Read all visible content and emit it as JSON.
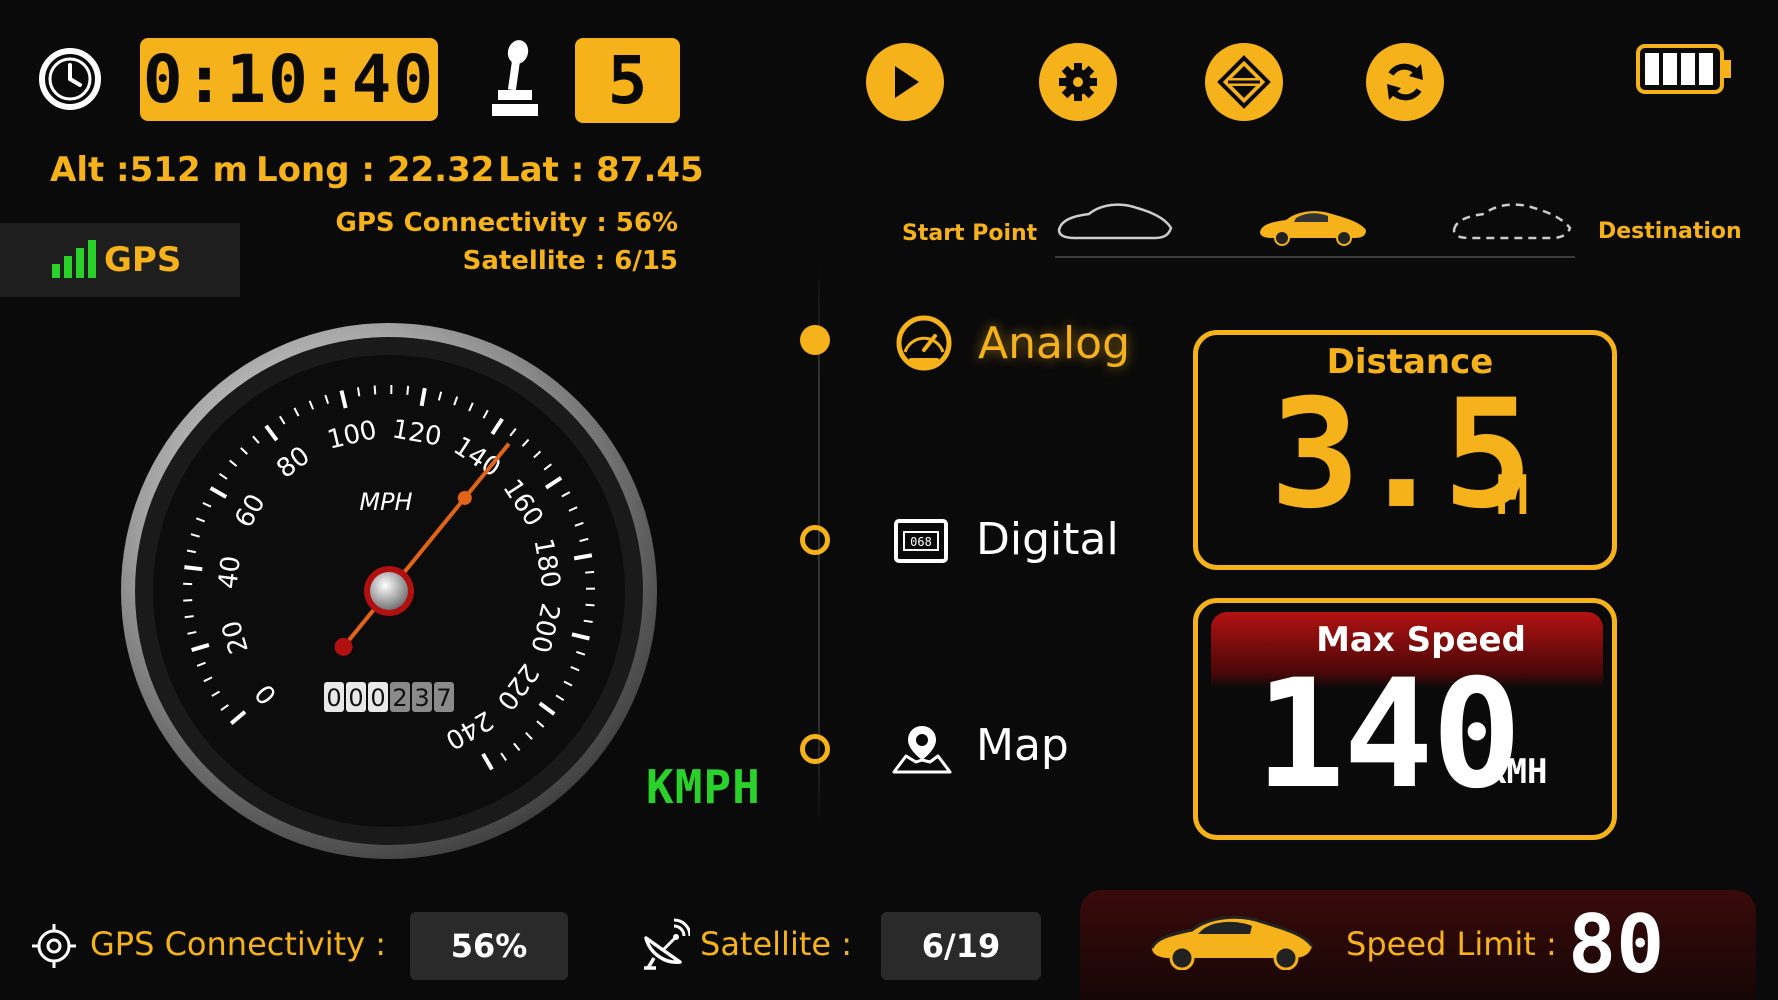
{
  "header": {
    "timer": "0:10:40",
    "gear": "5"
  },
  "location": {
    "alt": "Alt :512 m",
    "long": "Long : 22.32",
    "lat": "Lat : 87.45",
    "gps_connectivity": "GPS Connectivity : 56%",
    "satellite": "Satellite : 6/15"
  },
  "gps_badge": {
    "label": "GPS"
  },
  "route": {
    "start": "Start Point",
    "destination": "Destination"
  },
  "modes": [
    {
      "label": "Analog",
      "selected": true
    },
    {
      "label": "Digital",
      "selected": false
    },
    {
      "label": "Map",
      "selected": false
    }
  ],
  "distance": {
    "title": "Distance",
    "value": "3.5",
    "unit": "M"
  },
  "max_speed": {
    "title": "Max Speed",
    "value": "140",
    "unit": "KMH"
  },
  "speedometer": {
    "unit_label": "MPH",
    "ticks": [
      "0",
      "20",
      "40",
      "60",
      "80",
      "100",
      "120",
      "140",
      "160",
      "180",
      "200",
      "220",
      "240"
    ],
    "needle_value": 145,
    "max_value": 240,
    "odometer": [
      "0",
      "0",
      "0",
      "2",
      "3",
      "7"
    ]
  },
  "unit_toggle": "KMPH",
  "footer": {
    "gps_connectivity_label": "GPS Connectivity :",
    "gps_connectivity_value": "56%",
    "satellite_label": "Satellite :",
    "satellite_value": "6/19",
    "speed_limit_label": "Speed Limit :",
    "speed_limit_value": "80"
  },
  "colors": {
    "accent": "#f5b21a",
    "gps_green": "#2bd12b",
    "speed_red": "#b31212",
    "background": "#0a0a0a"
  }
}
